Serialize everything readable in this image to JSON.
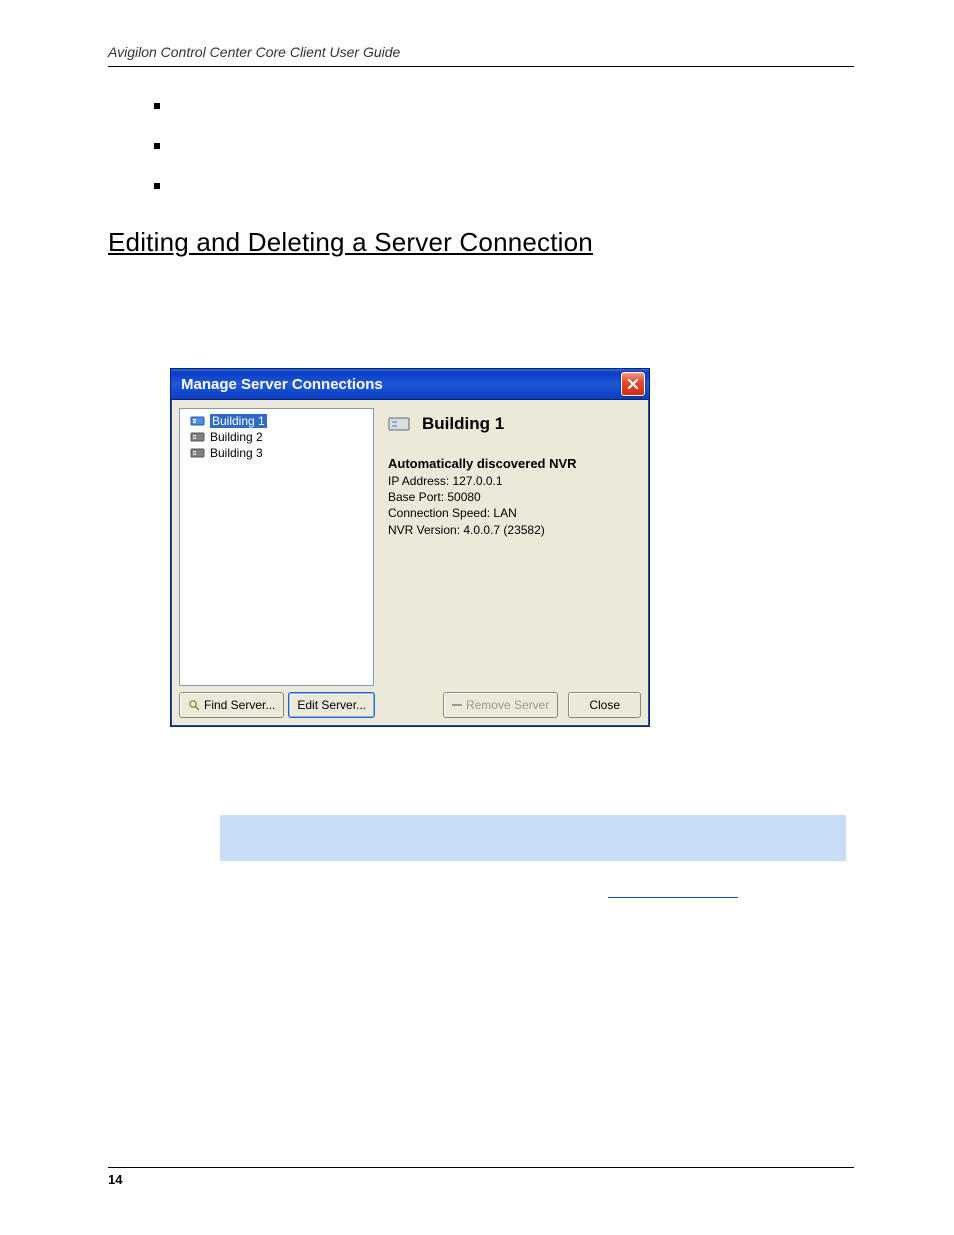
{
  "doc": {
    "running_head": "Avigilon Control Center Core Client User Guide",
    "page_number": "14",
    "heading": "Editing and Deleting a Server Connection"
  },
  "dialog": {
    "title": "Manage Server Connections",
    "servers": [
      {
        "name": "Building 1",
        "selected": true,
        "connected": true
      },
      {
        "name": "Building 2",
        "selected": false,
        "connected": false
      },
      {
        "name": "Building 3",
        "selected": false,
        "connected": false
      }
    ],
    "detail": {
      "title": "Building 1",
      "subhead": "Automatically discovered NVR",
      "ip": "IP Address: 127.0.0.1",
      "port": "Base Port: 50080",
      "speed": "Connection Speed: LAN",
      "ver": "NVR Version: 4.0.0.7 (23582)"
    },
    "buttons": {
      "find": "Find Server...",
      "edit": "Edit Server...",
      "remove": "Remove Server",
      "close": "Close"
    }
  }
}
